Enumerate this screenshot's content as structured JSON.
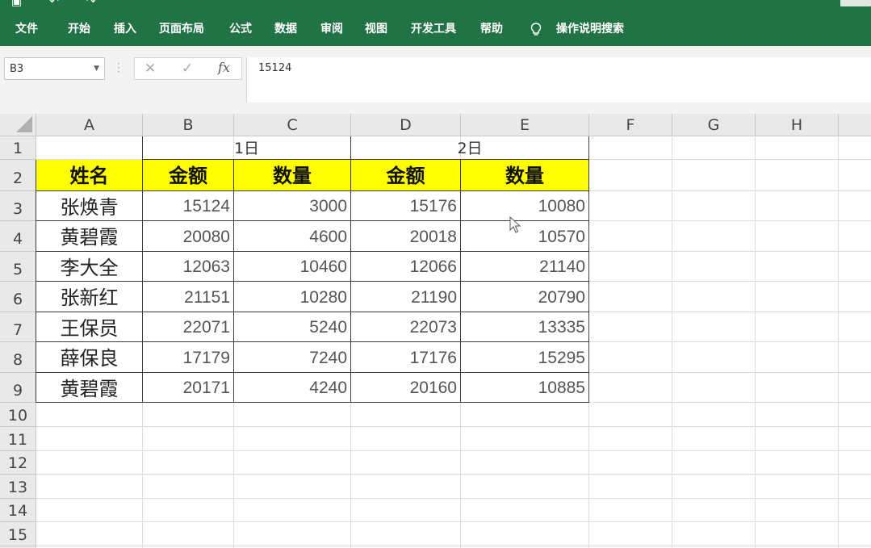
{
  "ribbon": {
    "tabs": [
      "文件",
      "开始",
      "插入",
      "页面布局",
      "公式",
      "数据",
      "审阅",
      "视图",
      "开发工具",
      "帮助"
    ],
    "tell_me": "操作说明搜索"
  },
  "formula_bar": {
    "name_box": "B3",
    "value": "15124",
    "fx_label": "fx"
  },
  "columns": [
    "A",
    "B",
    "C",
    "D",
    "E",
    "F",
    "G",
    "H"
  ],
  "rows": [
    "1",
    "2",
    "3",
    "4",
    "5",
    "6",
    "7",
    "8",
    "9",
    "10",
    "11",
    "12",
    "13",
    "14",
    "15"
  ],
  "sheet": {
    "group_headers": [
      "1日",
      "2日"
    ],
    "field_headers": [
      "姓名",
      "金额",
      "数量",
      "金额",
      "数量"
    ],
    "records": [
      [
        "张焕青",
        "15124",
        "3000",
        "15176",
        "10080"
      ],
      [
        "黄碧霞",
        "20080",
        "4600",
        "20018",
        "10570"
      ],
      [
        "李大全",
        "12063",
        "10460",
        "12066",
        "21140"
      ],
      [
        "张新红",
        "21151",
        "10280",
        "21190",
        "20790"
      ],
      [
        "王保员",
        "22071",
        "5240",
        "22073",
        "13335"
      ],
      [
        "薛保良",
        "17179",
        "7240",
        "17176",
        "15295"
      ],
      [
        "黄碧霞",
        "20171",
        "4240",
        "20160",
        "10885"
      ]
    ]
  },
  "colors": {
    "ribbon": "#217346",
    "header_fill": "#ffff00"
  }
}
